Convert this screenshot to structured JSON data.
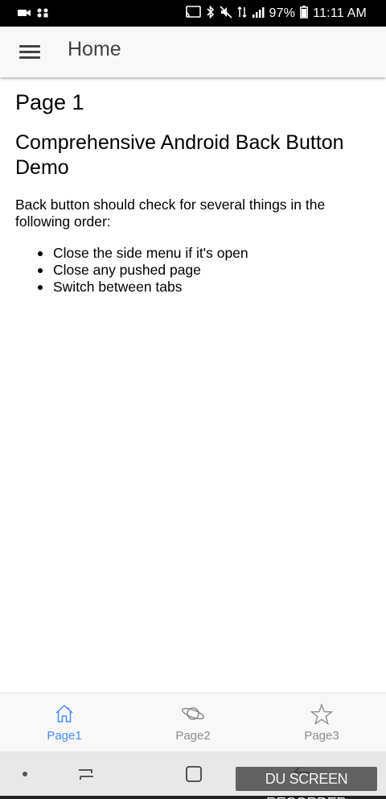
{
  "status_bar": {
    "battery": "97%",
    "time": "11:11 AM",
    "left_icons": [
      "video-notification-icon",
      "usb-notification-icon"
    ],
    "right_icons": [
      "cast-icon",
      "bluetooth-icon",
      "mute-icon",
      "data-icon",
      "signal-icon",
      "battery-icon"
    ]
  },
  "app_bar": {
    "title": "Home",
    "menu_icon": "hamburger-icon"
  },
  "content": {
    "page_heading": "Page 1",
    "sub_heading": "Comprehensive Android Back Button Demo",
    "body": "Back button should check for several things in the following order:",
    "list": [
      "Close the side menu if it's open",
      "Close any pushed page",
      "Switch between tabs"
    ]
  },
  "tabs": [
    {
      "label": "Page1",
      "icon": "home-icon",
      "active": true
    },
    {
      "label": "Page2",
      "icon": "planet-icon",
      "active": false
    },
    {
      "label": "Page3",
      "icon": "star-icon",
      "active": false
    }
  ],
  "nav_bar": {
    "icons": [
      "dot-icon",
      "recent-apps-icon",
      "home-square-icon",
      "back-icon"
    ]
  },
  "watermark": "DU SCREEN RECORDER",
  "colors": {
    "accent": "#488aff",
    "inactive_tab": "#8c8c8c",
    "toolbar_bg": "#f8f8f8",
    "status_bar_bg": "#000000"
  }
}
